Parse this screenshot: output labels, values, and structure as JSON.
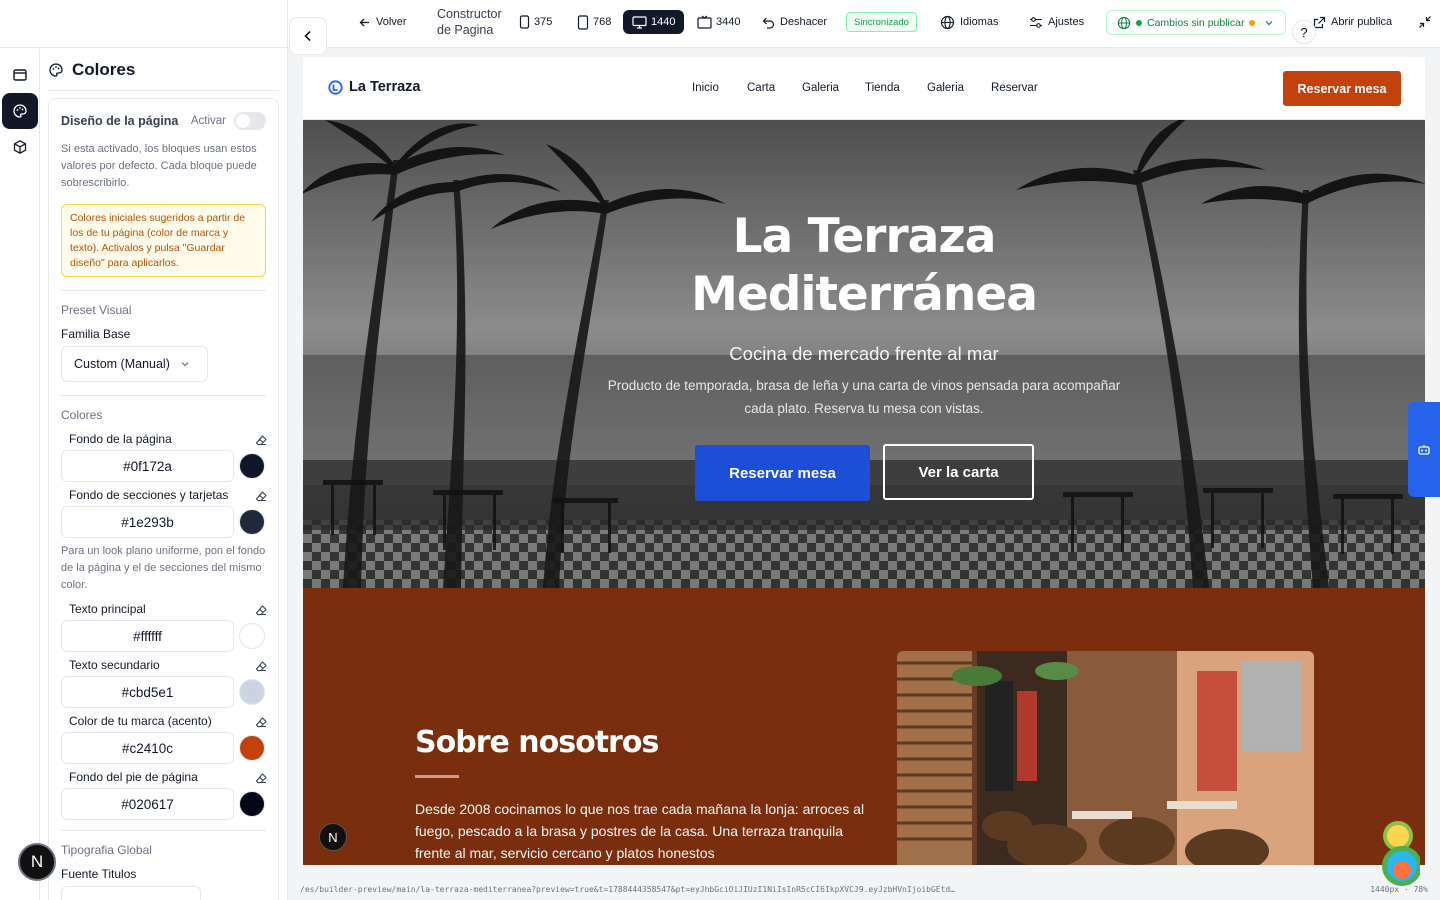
{
  "toolbar": {
    "back": "Volver",
    "title": "Constructor de Pagina",
    "devices": [
      "375",
      "768",
      "1440",
      "3440"
    ],
    "undo": "Deshacer",
    "sync": "Sincronizado",
    "languages": "Idiomas",
    "settings": "Ajustes",
    "unpublished": "Cambios sin publicar",
    "help": "?",
    "open_public": "Abrir publica"
  },
  "panel": {
    "title": "Colores",
    "design_label": "Diseño de la página",
    "activate_label": "Activar",
    "design_help": "Si esta activado, los bloques usan estos valores por defecto. Cada bloque puede sobrescribirlo.",
    "notice": "Colores iniciales sugeridos a partir de los de tu página (color de marca y texto). Activalos y pulsa \"Guardar diseño\" para aplicarlos.",
    "preset_title": "Preset Visual",
    "family_label": "Familia Base",
    "family_value": "Custom (Manual)",
    "colors_title": "Colores",
    "colors": [
      {
        "label": "Fondo de la página",
        "hex": "#0f172a"
      },
      {
        "label": "Fondo de secciones y tarjetas",
        "hex": "#1e293b"
      },
      {
        "label": "Texto principal",
        "hex": "#ffffff"
      },
      {
        "label": "Texto secundario",
        "hex": "#cbd5e1"
      },
      {
        "label": "Color de tu marca (acento)",
        "hex": "#c2410c"
      },
      {
        "label": "Fondo del pie de página",
        "hex": "#020617"
      }
    ],
    "flat_help": "Para un look plano uniforme, pon el fondo de la página y el de secciones del mismo color.",
    "typography_title": "Tipografia Global",
    "heading_font_label": "Fuente Titulos",
    "avatar": "N"
  },
  "site": {
    "brand": "La Terraza",
    "nav": [
      "Inicio",
      "Carta",
      "Galeria",
      "Tienda",
      "Galeria",
      "Reservar"
    ],
    "nav_cta": "Reservar mesa",
    "hero_title_1": "La Terraza",
    "hero_title_2": "Mediterránea",
    "hero_subtitle": "Cocina de mercado frente al mar",
    "hero_desc": "Producto de temporada, brasa de leña y una carta de vinos pensada para acompañar cada plato. Reserva tu mesa con vistas.",
    "hero_btn_primary": "Reservar mesa",
    "hero_btn_secondary": "Ver la carta",
    "about_title": "Sobre nosotros",
    "about_text": "Desde 2008 cocinamos lo que nos trae cada mañana la lonja: arroces al fuego, pescado a la brasa y postres de la casa. Una terraza tranquila frente al mar, servicio cercano y platos honestos",
    "badge": "N"
  },
  "status": {
    "url": "/es/builder-preview/main/la-terraza-mediterranea?preview=true&t=1788444358547&pt=eyJhbGciOiJIUzI1NiIsInR5cCI6IkpXVCJ9.eyJzbHVnIjoibGEtd…",
    "info": "1440px · 78%"
  },
  "colors": {
    "accent": "#c2410c",
    "primary_button": "#1d4ed8",
    "about_bg": "#7a2e0e",
    "active_dark": "#111827"
  }
}
